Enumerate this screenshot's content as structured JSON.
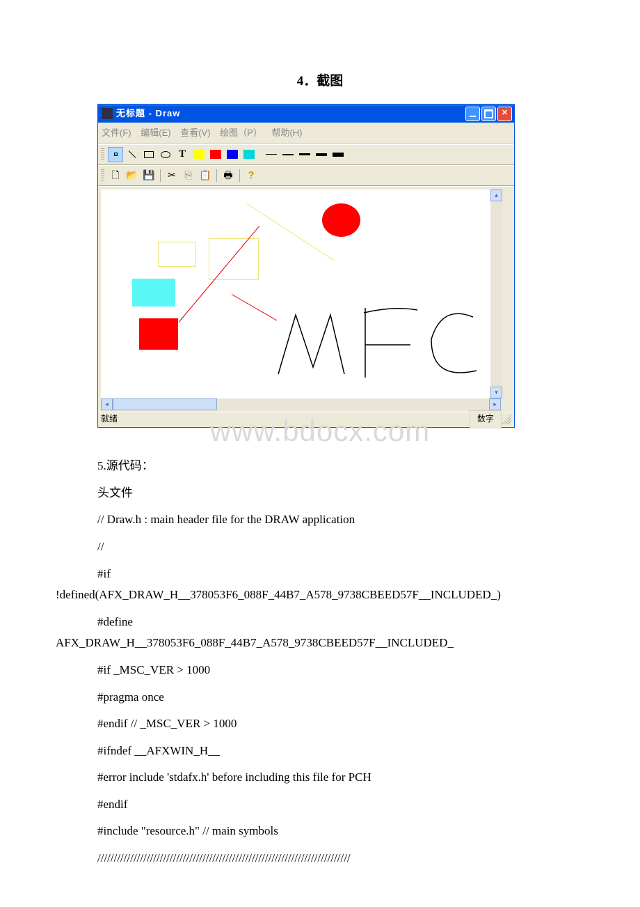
{
  "heading": "4．截图",
  "window": {
    "title": "无标题 - Draw",
    "menu": {
      "file": "文件(F)",
      "edit": "编辑(E)",
      "view": "查看(V)",
      "draw": "绘图（P）",
      "help": "帮助(H)"
    },
    "lineWidths": [
      1,
      2,
      3,
      4,
      6
    ],
    "status_ready": "就绪",
    "status_num": "数字"
  },
  "text": {
    "t1": "5.源代码：",
    "t2": " 头文件",
    "t3": "// Draw.h : main header file for the DRAW application",
    "t4": "//",
    "t5_a": "#if",
    "t5_b": "!defined(AFX_DRAW_H__378053F6_088F_44B7_A578_9738CBEED57F__INCLUDED_)",
    "t6_a": "#define",
    "t6_b": "AFX_DRAW_H__378053F6_088F_44B7_A578_9738CBEED57F__INCLUDED_",
    "t7": "#if _MSC_VER > 1000",
    "t8": "#pragma once",
    "t9": "#endif // _MSC_VER > 1000",
    "t10": "#ifndef __AFXWIN_H__",
    "t11": " #error include 'stdafx.h' before including this file for PCH",
    "t12": "#endif",
    "t13": "#include \"resource.h\" // main symbols",
    "t14": "/////////////////////////////////////////////////////////////////////////////"
  },
  "watermark": "www.bdocx.com"
}
